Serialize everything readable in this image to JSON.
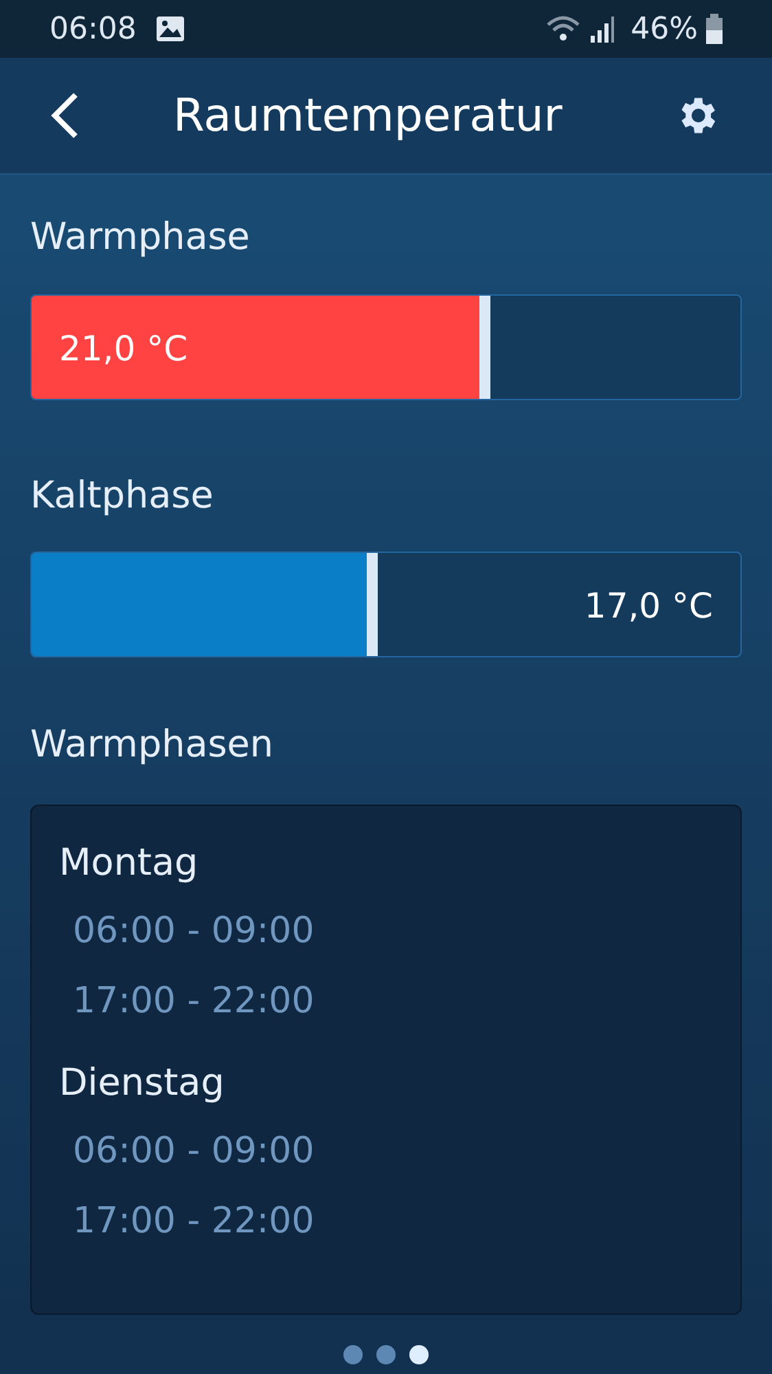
{
  "status_bar": {
    "time": "06:08",
    "battery": "46%"
  },
  "header": {
    "title": "Raumtemperatur"
  },
  "sliders": [
    {
      "label": "Warmphase",
      "kind": "warm",
      "level": 0.64,
      "reading": "21,0 °C"
    },
    {
      "label": "Kaltphase",
      "kind": "cold",
      "level": 0.48,
      "reading": "17,0 °C"
    }
  ],
  "schedule": {
    "title": "Warmphasen",
    "days": [
      {
        "day": "Montag",
        "periods": [
          "06:00 - 09:00",
          "17:00 - 22:00"
        ]
      },
      {
        "day": "Dienstag",
        "periods": [
          "06:00 - 09:00",
          "17:00 - 22:00"
        ]
      }
    ]
  },
  "pager": [
    {
      "selected": false
    },
    {
      "selected": false
    },
    {
      "selected": true
    }
  ]
}
